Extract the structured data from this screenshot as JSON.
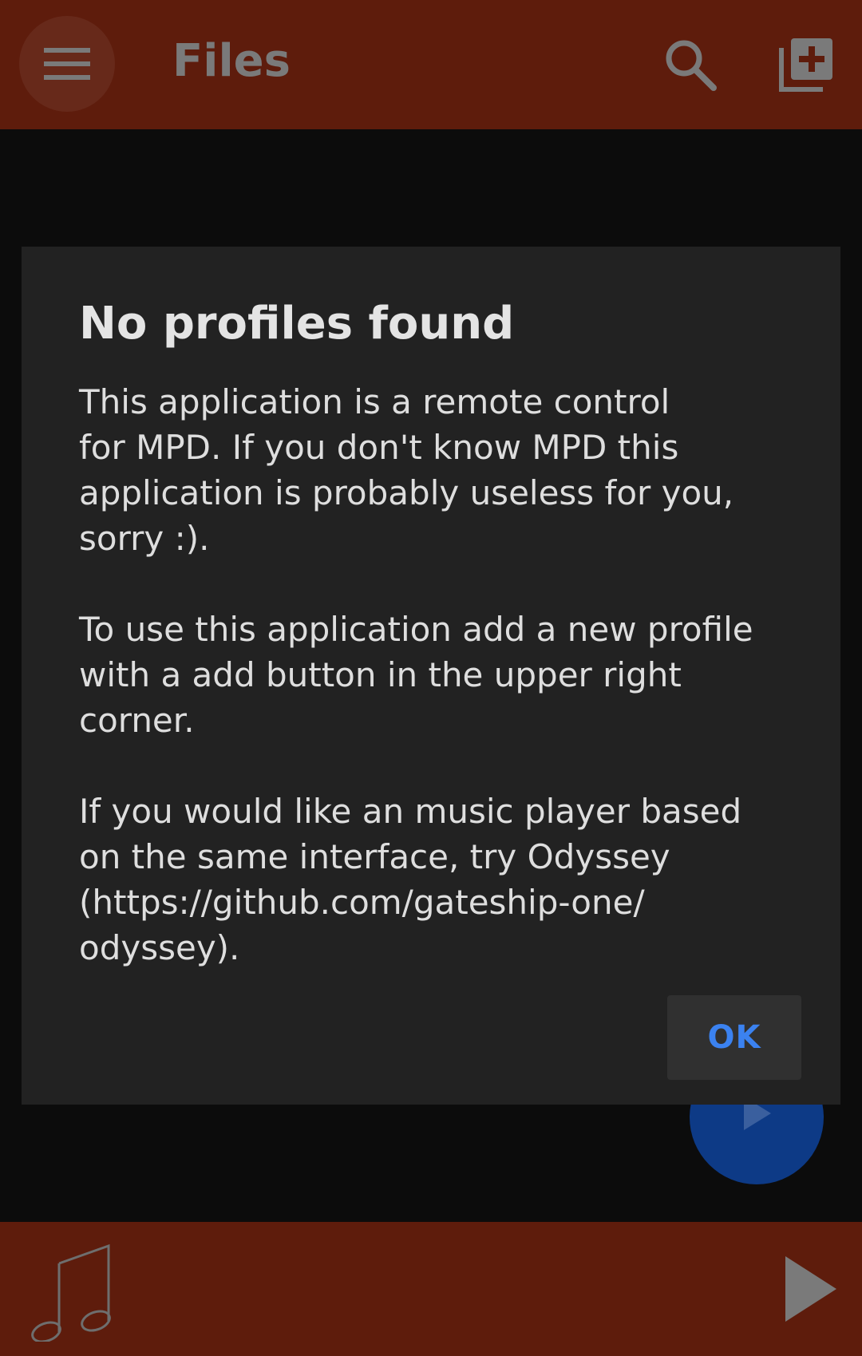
{
  "toolbar": {
    "title": "Files",
    "menu_icon": "hamburger-menu-icon",
    "search_icon": "search-icon",
    "add_icon": "library-add-icon"
  },
  "dialog": {
    "title": "No profiles found",
    "message": "This application is a remote control\nfor MPD. If you don't know MPD this\napplication is probably useless for you,\nsorry :).\n\nTo use this application add a new profile\nwith a add button in the upper right\ncorner.\n\nIf you would like an music player based\non the same interface, try Odyssey\n(https://github.com/gateship-one/\nodyssey).",
    "ok_label": "OK"
  },
  "fab": {
    "icon": "play-icon"
  },
  "bottom_bar": {
    "album_art_icon": "music-note-icon",
    "play_icon": "play-icon"
  },
  "colors": {
    "primary": "#5e1c0c",
    "background": "#0c0c0c",
    "dialog": "#222222",
    "accent": "#3b82f0",
    "fab": "#0d3a86"
  }
}
